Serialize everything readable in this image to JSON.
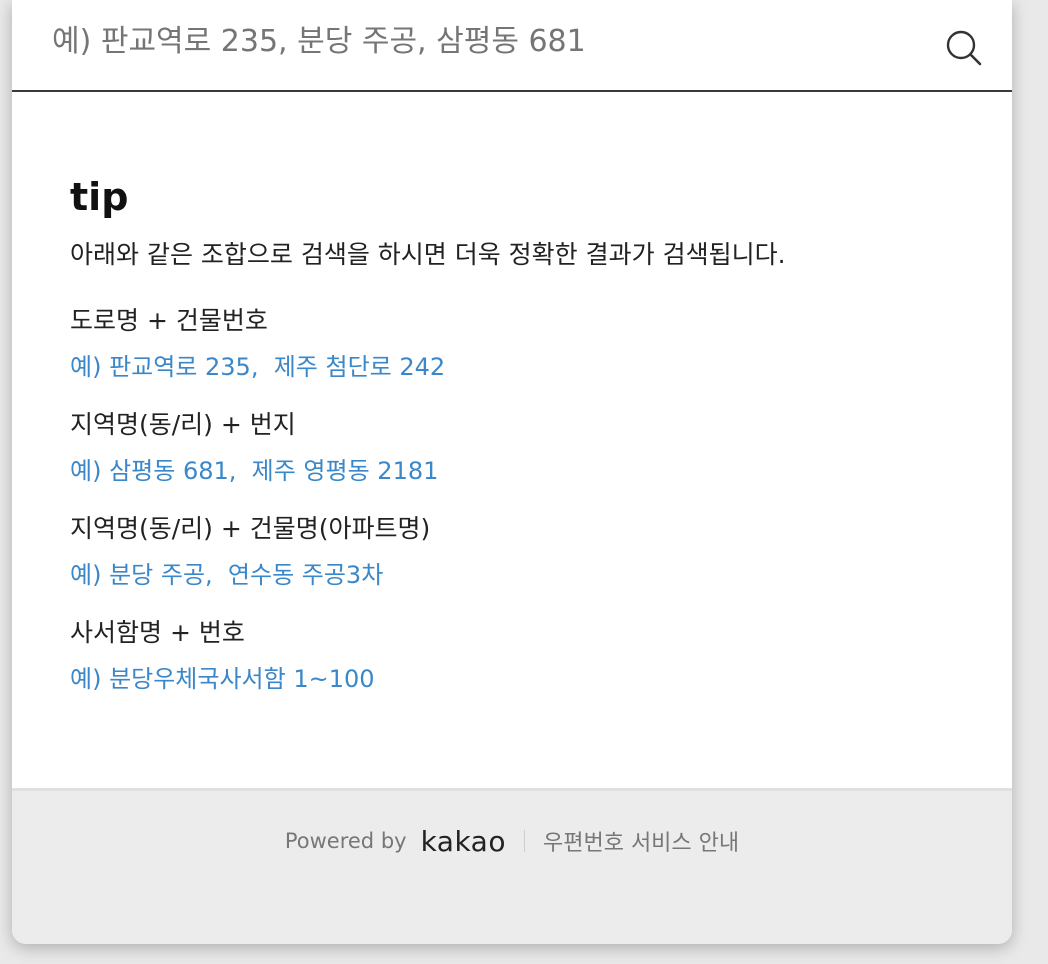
{
  "search": {
    "placeholder": "예) 판교역로 235, 분당 주공, 삼평동 681"
  },
  "tip": {
    "title": "tip",
    "description": "아래와 같은 조합으로 검색을 하시면 더욱 정확한 결과가 검색됩니다.",
    "combinations": [
      {
        "label": "도로명 + 건물번호",
        "example": "예) 판교역로 235,  제주 첨단로 242"
      },
      {
        "label": "지역명(동/리) + 번지",
        "example": "예) 삼평동 681,  제주 영평동 2181"
      },
      {
        "label": "지역명(동/리) + 건물명(아파트명)",
        "example": "예) 분당 주공,  연수동 주공3차"
      },
      {
        "label": "사서함명 + 번호",
        "example": "예) 분당우체국사서함 1~100"
      }
    ]
  },
  "footer": {
    "powered_by": "Powered by",
    "logo": "kakao",
    "service_link": "우편번호 서비스 안내"
  },
  "icons": {
    "search": "search-icon"
  },
  "colors": {
    "example_text": "#3a87c9",
    "footer_bg": "#ececec",
    "search_underline": "#3a3a3a"
  }
}
